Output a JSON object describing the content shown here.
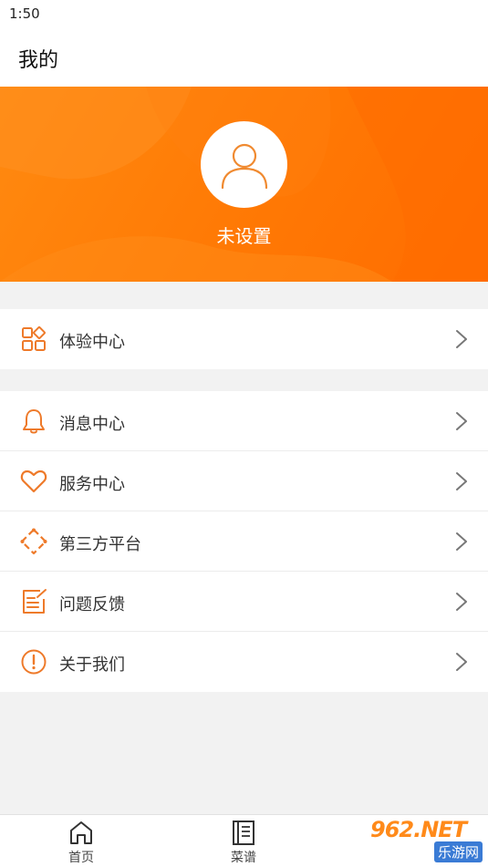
{
  "status_bar": {
    "time": "1:50"
  },
  "header": {
    "title": "我的"
  },
  "profile": {
    "username": "未设置",
    "avatar_icon": "user-avatar-icon"
  },
  "menu_groups": [
    {
      "items": [
        {
          "label": "体验中心",
          "icon": "grid-apps-icon"
        }
      ]
    },
    {
      "items": [
        {
          "label": "消息中心",
          "icon": "bell-icon"
        },
        {
          "label": "服务中心",
          "icon": "heart-icon"
        },
        {
          "label": "第三方平台",
          "icon": "dotted-diamond-icon"
        },
        {
          "label": "问题反馈",
          "icon": "feedback-edit-icon"
        },
        {
          "label": "关于我们",
          "icon": "info-exclamation-icon"
        }
      ]
    }
  ],
  "tab_bar": [
    {
      "label": "首页",
      "icon": "home-icon"
    },
    {
      "label": "菜谱",
      "icon": "recipe-book-icon"
    }
  ],
  "watermark": {
    "logo": "962.NET",
    "sub": "乐游网"
  },
  "colors": {
    "accent": "#ff7a05",
    "icon": "#ee7a2a",
    "background": "#f2f2f2"
  }
}
